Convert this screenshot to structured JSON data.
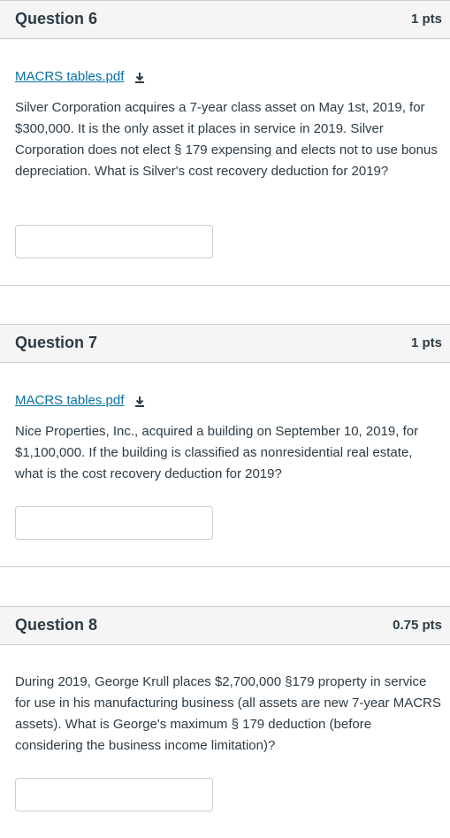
{
  "questions": [
    {
      "title": "Question 6",
      "points": "1 pts",
      "attachment": "MACRS tables.pdf",
      "text": "Silver Corporation acquires a 7-year class asset on May 1st, 2019, for $300,000. It is the only asset it places in service in 2019. Silver Corporation does not elect § 179 expensing and elects not to use bonus depreciation. What is Silver's cost recovery deduction for 2019?",
      "answer": ""
    },
    {
      "title": "Question 7",
      "points": "1 pts",
      "attachment": "MACRS tables.pdf",
      "text": "Nice Properties, Inc., acquired a building on September 10, 2019, for $1,100,000. If the building is classified as nonresidential real estate, what is the cost recovery deduction for 2019?",
      "answer": ""
    },
    {
      "title": "Question 8",
      "points": "0.75 pts",
      "text": "During 2019, George Krull places $2,700,000 §179 property in service for use in his manufacturing business (all assets are new 7-year MACRS assets). What is George's maximum § 179 deduction (before considering the business income limitation)?",
      "answer": ""
    }
  ],
  "icons": {
    "download": "download-icon"
  }
}
